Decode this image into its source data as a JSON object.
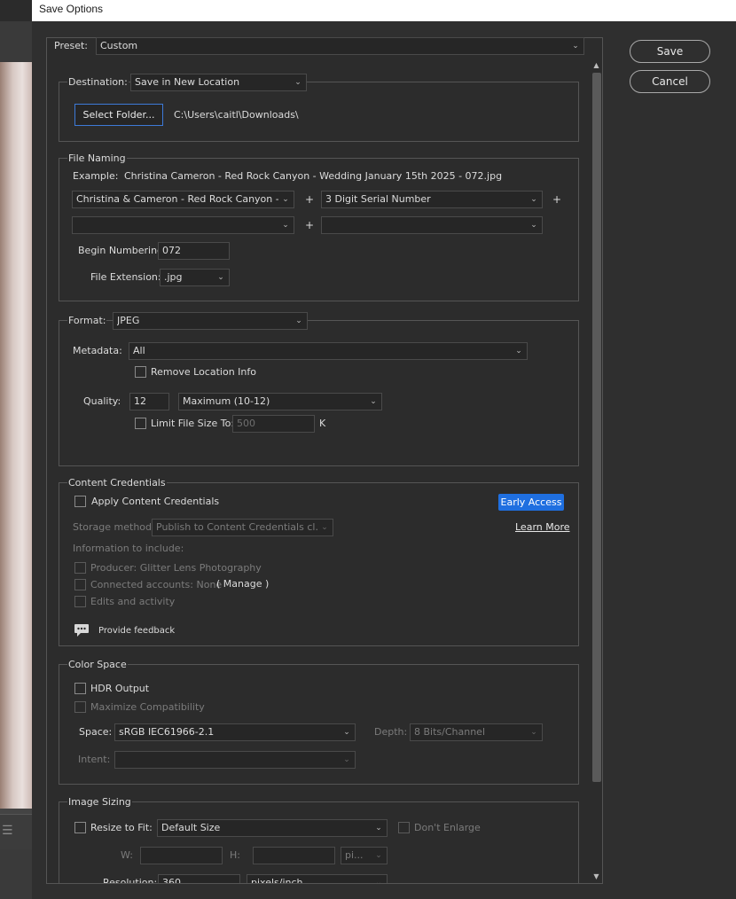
{
  "window": {
    "title": "Save Options"
  },
  "actions": {
    "save": "Save",
    "cancel": "Cancel"
  },
  "preset": {
    "label": "Preset:",
    "value": "Custom"
  },
  "destination": {
    "label": "Destination:",
    "value": "Save in New Location",
    "select_folder": "Select Folder...",
    "path": "C:\\Users\\caitl\\Downloads\\"
  },
  "file_naming": {
    "title": "File Naming",
    "example_label": "Example:",
    "example_value": "Christina  Cameron - Red Rock Canyon - Wedding January 15th 2025 - 072.jpg",
    "field1": "Christina & Cameron - Red Rock Canyon - Wed",
    "field2": "3 Digit Serial Number",
    "field3": "",
    "field4": "",
    "plus": "+",
    "begin_numbering_label": "Begin Numbering:",
    "begin_numbering_value": "072",
    "file_extension_label": "File Extension:",
    "file_extension_value": ".jpg"
  },
  "format": {
    "label": "Format:",
    "value": "JPEG",
    "metadata_label": "Metadata:",
    "metadata_value": "All",
    "remove_location": "Remove Location Info",
    "quality_label": "Quality:",
    "quality_value": "12",
    "quality_preset": "Maximum  (10-12)",
    "limit_label": "Limit File Size To:",
    "limit_value": "500",
    "limit_unit": "K"
  },
  "content_credentials": {
    "title": "Content Credentials",
    "apply": "Apply Content Credentials",
    "early_access": "Early Access",
    "storage_label": "Storage method:",
    "storage_value": "Publish to Content Credentials cl...",
    "learn_more": "Learn More",
    "info_label": "Information to include:",
    "producer": "Producer: Glitter Lens Photography",
    "connected": "Connected accounts: None",
    "manage": "( Manage )",
    "edits": "Edits and activity",
    "feedback": "Provide feedback"
  },
  "color_space": {
    "title": "Color Space",
    "hdr": "HDR Output",
    "maximize": "Maximize Compatibility",
    "space_label": "Space:",
    "space_value": "sRGB IEC61966-2.1",
    "depth_label": "Depth:",
    "depth_value": "8 Bits/Channel",
    "intent_label": "Intent:",
    "intent_value": ""
  },
  "image_sizing": {
    "title": "Image Sizing",
    "resize": "Resize to Fit:",
    "resize_value": "Default Size",
    "dont_enlarge": "Don't Enlarge",
    "w_label": "W:",
    "h_label": "H:",
    "unit_value": "pi...",
    "resolution_label": "Resolution:",
    "resolution_value": "360",
    "resolution_unit": "pixels/inch"
  },
  "icons": {
    "chevron": "chevron-down-icon",
    "feedback": "speech-bubble-icon",
    "tool": "align-left-icon"
  },
  "colors": {
    "accent": "#1f6fe0",
    "folder_border": "#3d7ad8",
    "background": "#2f2f2f"
  }
}
